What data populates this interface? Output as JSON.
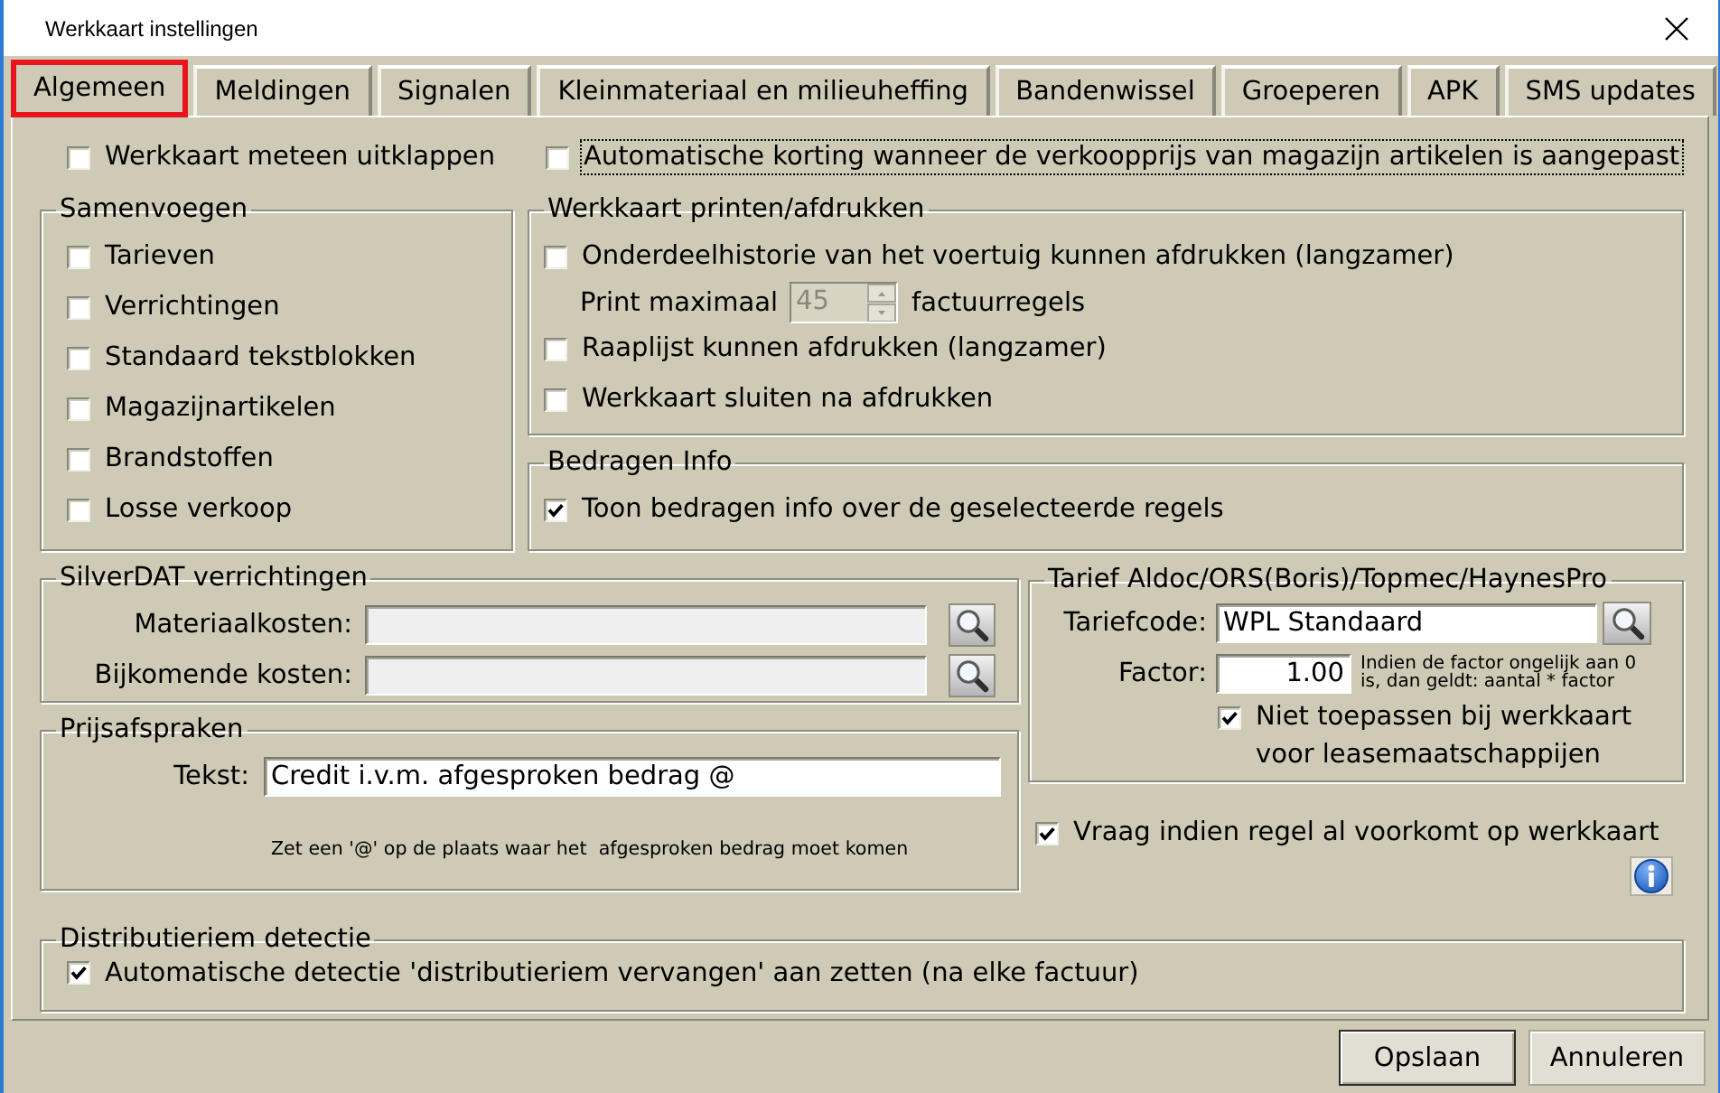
{
  "window": {
    "title": "Werkkaart instellingen"
  },
  "tabs": [
    {
      "label": "Algemeen",
      "selected": true
    },
    {
      "label": "Meldingen",
      "selected": false
    },
    {
      "label": "Signalen",
      "selected": false
    },
    {
      "label": "Kleinmateriaal en milieuheffing",
      "selected": false
    },
    {
      "label": "Bandenwissel",
      "selected": false
    },
    {
      "label": "Groeperen",
      "selected": false
    },
    {
      "label": "APK",
      "selected": false
    },
    {
      "label": "SMS updates",
      "selected": false
    }
  ],
  "top_options": [
    {
      "label": "Werkkaart meteen uitklappen",
      "checked": false,
      "focused": false
    },
    {
      "label": "Automatische korting wanneer de verkoopprijs van magazijn artikelen is aangepast",
      "checked": false,
      "focused": true
    }
  ],
  "merge_group": {
    "title": "Samenvoegen",
    "items": [
      {
        "label": "Tarieven",
        "checked": false
      },
      {
        "label": "Verrichtingen",
        "checked": false
      },
      {
        "label": "Standaard tekstblokken",
        "checked": false
      },
      {
        "label": "Magazijnartikelen",
        "checked": false
      },
      {
        "label": "Brandstoffen",
        "checked": false
      },
      {
        "label": "Losse verkoop",
        "checked": false
      }
    ]
  },
  "print_group": {
    "title": "Werkkaart printen/afdrukken",
    "items": [
      {
        "kind": "checkbox",
        "label": "Onderdeelhistorie van het voertuig kunnen afdrukken (langzamer)",
        "checked": false
      },
      {
        "kind": "spinner",
        "label": "Print maximaal",
        "value": "45",
        "unit": "factuurregels",
        "disabled": true
      },
      {
        "kind": "checkbox",
        "label": "Raaplijst kunnen afdrukken (langzamer)",
        "checked": false
      },
      {
        "kind": "checkbox",
        "label": "Werkkaart sluiten na afdrukken",
        "checked": false
      }
    ]
  },
  "amounts_group": {
    "title": "Bedragen Info",
    "items": [
      {
        "label": "Toon bedragen info over de geselecteerde regels",
        "checked": true
      }
    ]
  },
  "silverdat_group": {
    "title": "SilverDAT verrichtingen",
    "fields": [
      {
        "label": "Materiaalkosten:",
        "disabled": true
      },
      {
        "label": "Bijkomende kosten:",
        "disabled": true
      }
    ]
  },
  "price_group": {
    "title": "Prijsafspraken",
    "field": {
      "label": "Tekst:",
      "value": "Credit i.v.m. afgesproken bedrag @",
      "disabled": false
    },
    "hint": "Zet een '@' op de plaats waar het  afgesproken bedrag moet komen"
  },
  "rate_group": {
    "title": "Tarief Aldoc/ORS(Boris)/Topmec/HaynesPro",
    "code": {
      "label": "Tariefcode:",
      "value": "WPL Standaard",
      "disabled": false
    },
    "factor": {
      "label": "Factor:",
      "value": "1.00",
      "disabled": false
    },
    "factor_note": "Indien de factor ongelijk aan 0 is, dan geldt: aantal * factor",
    "option": {
      "label": "Niet toepassen bij werkkaart voor leasemaatschappijen",
      "checked": true
    }
  },
  "ask_option": {
    "label": "Vraag indien regel al voorkomt op werkkaart",
    "checked": true
  },
  "timing_belt_group": {
    "title": "Distributieriem detectie",
    "items": [
      {
        "label": "Automatische detectie 'distributieriem vervangen' aan zetten (na elke factuur)",
        "checked": true
      }
    ]
  },
  "buttons": [
    {
      "label": "Opslaan",
      "default": true
    },
    {
      "label": "Annuleren",
      "default": false
    }
  ]
}
